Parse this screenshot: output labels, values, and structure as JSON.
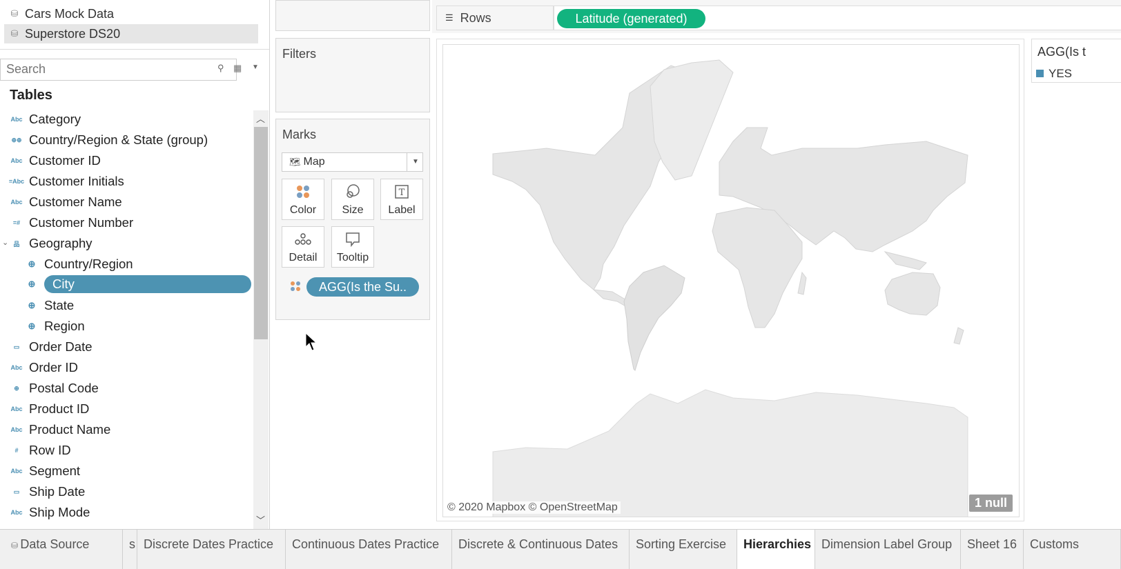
{
  "data_sources": [
    {
      "label": "Cars Mock Data",
      "icon": "database-icon",
      "selected": false
    },
    {
      "label": "Superstore DS20",
      "icon": "database-check-icon",
      "selected": true
    }
  ],
  "search": {
    "placeholder": "Search"
  },
  "tables_heading": "Tables",
  "fields": [
    {
      "label": "Category",
      "icon_text": "Abc"
    },
    {
      "label": "Country/Region & State (group)",
      "icon_text": "⊕⊕"
    },
    {
      "label": "Customer ID",
      "icon_text": "Abc"
    },
    {
      "label": "Customer Initials",
      "icon_text": "=Abc"
    },
    {
      "label": "Customer Name",
      "icon_text": "Abc"
    },
    {
      "label": "Customer Number",
      "icon_text": "=#"
    },
    {
      "label": "Geography",
      "icon_text": "品"
    },
    {
      "label": "Country/Region",
      "icon_text": "⊕"
    },
    {
      "label": "City",
      "icon_text": "⊕"
    },
    {
      "label": "State",
      "icon_text": "⊕"
    },
    {
      "label": "Region",
      "icon_text": "⊕"
    },
    {
      "label": "Order Date",
      "icon_text": "▭"
    },
    {
      "label": "Order ID",
      "icon_text": "Abc"
    },
    {
      "label": "Postal Code",
      "icon_text": "⊕"
    },
    {
      "label": "Product ID",
      "icon_text": "Abc"
    },
    {
      "label": "Product Name",
      "icon_text": "Abc"
    },
    {
      "label": "Row ID",
      "icon_text": "#"
    },
    {
      "label": "Segment",
      "icon_text": "Abc"
    },
    {
      "label": "Ship Date",
      "icon_text": "▭"
    },
    {
      "label": "Ship Mode",
      "icon_text": "Abc"
    }
  ],
  "filters": {
    "title": "Filters"
  },
  "marks": {
    "title": "Marks",
    "type_label": "Map",
    "buttons": {
      "color": "Color",
      "size": "Size",
      "label": "Label",
      "detail": "Detail",
      "tooltip": "Tooltip"
    },
    "color_pill": "AGG(Is the Su.."
  },
  "rows": {
    "label": "Rows",
    "pill": "Latitude (generated)"
  },
  "map": {
    "attribution": "© 2020 Mapbox © OpenStreetMap",
    "null_badge": "1 null"
  },
  "legend": {
    "title": "AGG(Is t",
    "item": "YES"
  },
  "tabs": [
    {
      "label": "Data Source",
      "active": false
    },
    {
      "label": "s",
      "active": false
    },
    {
      "label": "Discrete Dates Practice",
      "active": false
    },
    {
      "label": "Continuous Dates Practice",
      "active": false
    },
    {
      "label": "Discrete & Continuous Dates",
      "active": false
    },
    {
      "label": "Sorting Exercise",
      "active": false
    },
    {
      "label": "Hierarchies",
      "active": true
    },
    {
      "label": "Dimension Label Group",
      "active": false
    },
    {
      "label": "Sheet 16",
      "active": false
    },
    {
      "label": "Customs",
      "active": false
    }
  ],
  "colors": {
    "accent_blue": "#4d93b2",
    "rows_green": "#12b37f",
    "legend_yes": "#4a8fb3"
  }
}
